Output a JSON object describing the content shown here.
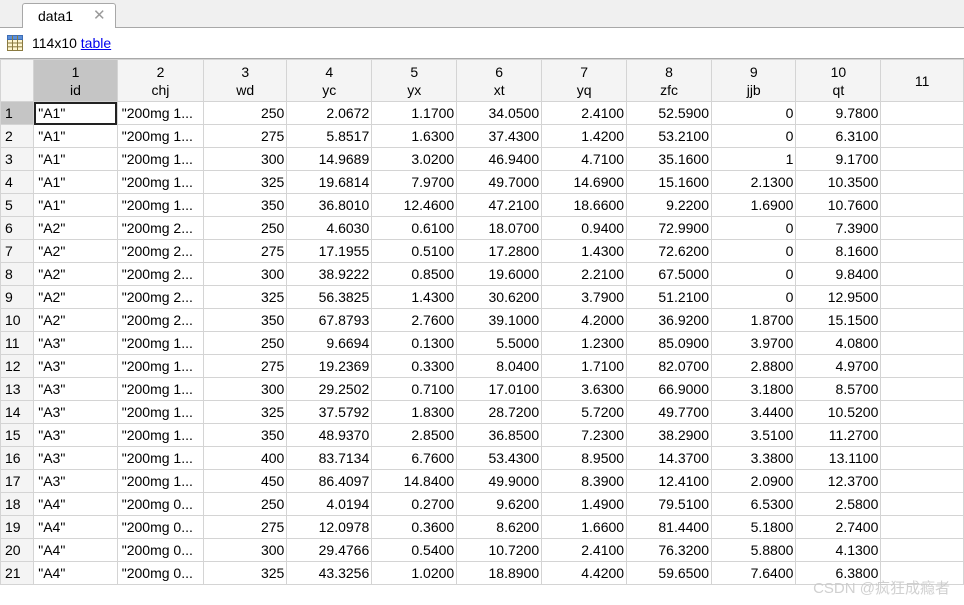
{
  "tab": {
    "label": "data1",
    "close_glyph": "✕"
  },
  "info": {
    "size": "114x10",
    "type_link": "table"
  },
  "columns": [
    {
      "index": "1",
      "name": "id"
    },
    {
      "index": "2",
      "name": "chj"
    },
    {
      "index": "3",
      "name": "wd"
    },
    {
      "index": "4",
      "name": "yc"
    },
    {
      "index": "5",
      "name": "yx"
    },
    {
      "index": "6",
      "name": "xt"
    },
    {
      "index": "7",
      "name": "yq"
    },
    {
      "index": "8",
      "name": "zfc"
    },
    {
      "index": "9",
      "name": "jjb"
    },
    {
      "index": "10",
      "name": "qt"
    },
    {
      "index": "11",
      "name": ""
    }
  ],
  "rows": [
    [
      "1",
      "\"A1\"",
      "\"200mg 1...",
      "250",
      "2.0672",
      "1.1700",
      "34.0500",
      "2.4100",
      "52.5900",
      "0",
      "9.7800"
    ],
    [
      "2",
      "\"A1\"",
      "\"200mg 1...",
      "275",
      "5.8517",
      "1.6300",
      "37.4300",
      "1.4200",
      "53.2100",
      "0",
      "6.3100"
    ],
    [
      "3",
      "\"A1\"",
      "\"200mg 1...",
      "300",
      "14.9689",
      "3.0200",
      "46.9400",
      "4.7100",
      "35.1600",
      "1",
      "9.1700"
    ],
    [
      "4",
      "\"A1\"",
      "\"200mg 1...",
      "325",
      "19.6814",
      "7.9700",
      "49.7000",
      "14.6900",
      "15.1600",
      "2.1300",
      "10.3500"
    ],
    [
      "5",
      "\"A1\"",
      "\"200mg 1...",
      "350",
      "36.8010",
      "12.4600",
      "47.2100",
      "18.6600",
      "9.2200",
      "1.6900",
      "10.7600"
    ],
    [
      "6",
      "\"A2\"",
      "\"200mg 2...",
      "250",
      "4.6030",
      "0.6100",
      "18.0700",
      "0.9400",
      "72.9900",
      "0",
      "7.3900"
    ],
    [
      "7",
      "\"A2\"",
      "\"200mg 2...",
      "275",
      "17.1955",
      "0.5100",
      "17.2800",
      "1.4300",
      "72.6200",
      "0",
      "8.1600"
    ],
    [
      "8",
      "\"A2\"",
      "\"200mg 2...",
      "300",
      "38.9222",
      "0.8500",
      "19.6000",
      "2.2100",
      "67.5000",
      "0",
      "9.8400"
    ],
    [
      "9",
      "\"A2\"",
      "\"200mg 2...",
      "325",
      "56.3825",
      "1.4300",
      "30.6200",
      "3.7900",
      "51.2100",
      "0",
      "12.9500"
    ],
    [
      "10",
      "\"A2\"",
      "\"200mg 2...",
      "350",
      "67.8793",
      "2.7600",
      "39.1000",
      "4.2000",
      "36.9200",
      "1.8700",
      "15.1500"
    ],
    [
      "11",
      "\"A3\"",
      "\"200mg 1...",
      "250",
      "9.6694",
      "0.1300",
      "5.5000",
      "1.2300",
      "85.0900",
      "3.9700",
      "4.0800"
    ],
    [
      "12",
      "\"A3\"",
      "\"200mg 1...",
      "275",
      "19.2369",
      "0.3300",
      "8.0400",
      "1.7100",
      "82.0700",
      "2.8800",
      "4.9700"
    ],
    [
      "13",
      "\"A3\"",
      "\"200mg 1...",
      "300",
      "29.2502",
      "0.7100",
      "17.0100",
      "3.6300",
      "66.9000",
      "3.1800",
      "8.5700"
    ],
    [
      "14",
      "\"A3\"",
      "\"200mg 1...",
      "325",
      "37.5792",
      "1.8300",
      "28.7200",
      "5.7200",
      "49.7700",
      "3.4400",
      "10.5200"
    ],
    [
      "15",
      "\"A3\"",
      "\"200mg 1...",
      "350",
      "48.9370",
      "2.8500",
      "36.8500",
      "7.2300",
      "38.2900",
      "3.5100",
      "11.2700"
    ],
    [
      "16",
      "\"A3\"",
      "\"200mg 1...",
      "400",
      "83.7134",
      "6.7600",
      "53.4300",
      "8.9500",
      "14.3700",
      "3.3800",
      "13.1100"
    ],
    [
      "17",
      "\"A3\"",
      "\"200mg 1...",
      "450",
      "86.4097",
      "14.8400",
      "49.9000",
      "8.3900",
      "12.4100",
      "2.0900",
      "12.3700"
    ],
    [
      "18",
      "\"A4\"",
      "\"200mg 0...",
      "250",
      "4.0194",
      "0.2700",
      "9.6200",
      "1.4900",
      "79.5100",
      "6.5300",
      "2.5800"
    ],
    [
      "19",
      "\"A4\"",
      "\"200mg 0...",
      "275",
      "12.0978",
      "0.3600",
      "8.6200",
      "1.6600",
      "81.4400",
      "5.1800",
      "2.7400"
    ],
    [
      "20",
      "\"A4\"",
      "\"200mg 0...",
      "300",
      "29.4766",
      "0.5400",
      "10.7200",
      "2.4100",
      "76.3200",
      "5.8800",
      "4.1300"
    ],
    [
      "21",
      "\"A4\"",
      "\"200mg 0...",
      "325",
      "43.3256",
      "1.0200",
      "18.8900",
      "4.4200",
      "59.6500",
      "7.6400",
      "6.3800"
    ]
  ],
  "watermark": "CSDN @疯狂成瘾者",
  "icons": {
    "table": "table-grid-icon",
    "close": "close-icon"
  },
  "colors": {
    "selected_header": "#c5c5c5",
    "link": "#0000ee",
    "grid_line": "#d4d4d4"
  }
}
